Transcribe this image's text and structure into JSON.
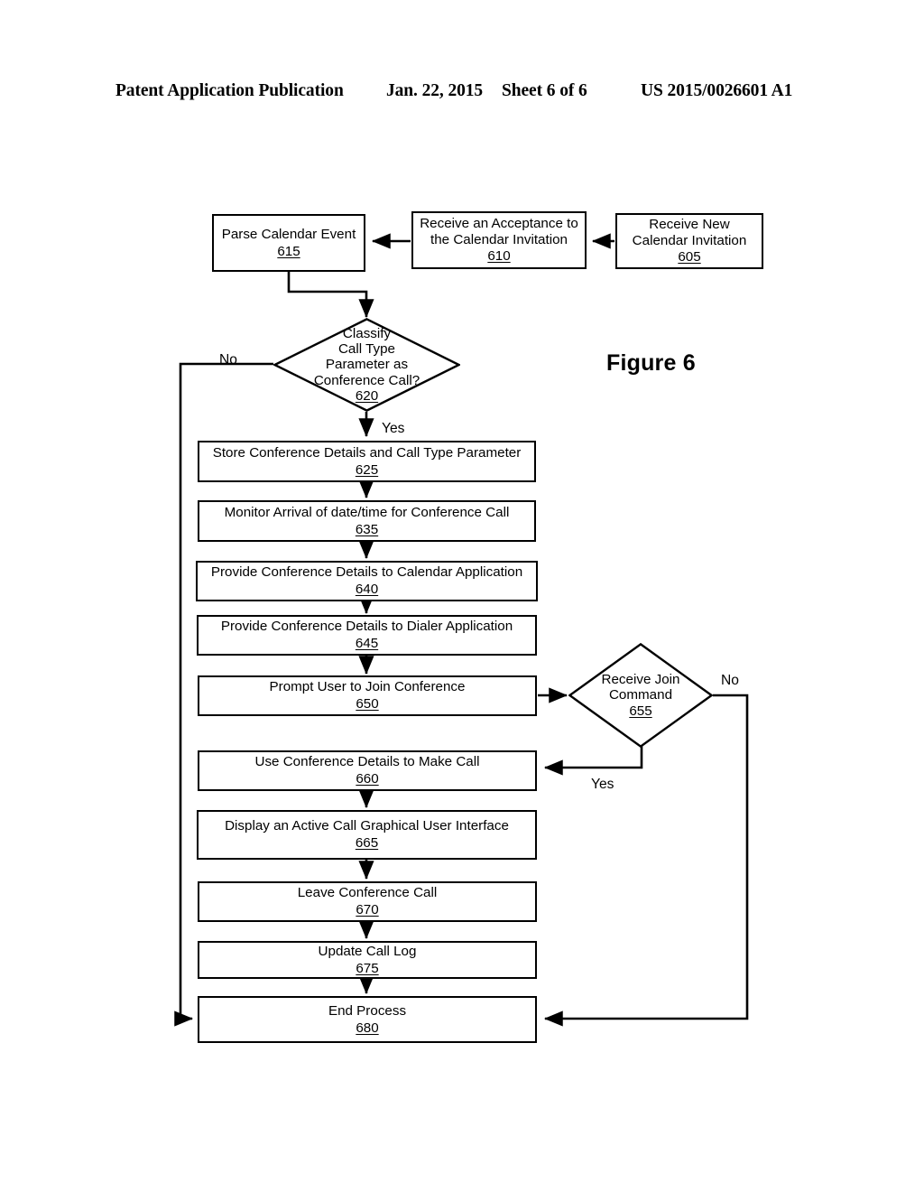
{
  "header": {
    "publication": "Patent Application Publication",
    "date": "Jan. 22, 2015",
    "sheet": "Sheet 6 of 6",
    "number": "US 2015/0026601 A1"
  },
  "figure": {
    "label": "Figure 6"
  },
  "flowchart": {
    "type": "flowchart",
    "nodes": [
      {
        "id": "605",
        "shape": "process",
        "text": "Receive New\nCalendar Invitation",
        "ref": "605"
      },
      {
        "id": "610",
        "shape": "process",
        "text": "Receive an Acceptance to\nthe Calendar Invitation",
        "ref": "610"
      },
      {
        "id": "615",
        "shape": "process",
        "text": "Parse Calendar Event",
        "ref": "615"
      },
      {
        "id": "620",
        "shape": "decision",
        "text": "Classify\nCall Type\nParameter as\nConference Call?",
        "ref": "620"
      },
      {
        "id": "625",
        "shape": "process",
        "text": "Store Conference Details and Call Type Parameter",
        "ref": "625"
      },
      {
        "id": "635",
        "shape": "process",
        "text": "Monitor Arrival of date/time for Conference Call",
        "ref": "635"
      },
      {
        "id": "640",
        "shape": "process",
        "text": "Provide Conference Details to Calendar Application",
        "ref": "640"
      },
      {
        "id": "645",
        "shape": "process",
        "text": "Provide Conference Details to Dialer Application",
        "ref": "645"
      },
      {
        "id": "650",
        "shape": "process",
        "text": "Prompt User to Join Conference",
        "ref": "650"
      },
      {
        "id": "655",
        "shape": "decision",
        "text": "Receive Join\nCommand",
        "ref": "655"
      },
      {
        "id": "660",
        "shape": "process",
        "text": "Use Conference Details to Make Call",
        "ref": "660"
      },
      {
        "id": "665",
        "shape": "process",
        "text": "Display an Active Call Graphical User Interface",
        "ref": "665"
      },
      {
        "id": "670",
        "shape": "process",
        "text": "Leave Conference Call",
        "ref": "670"
      },
      {
        "id": "675",
        "shape": "process",
        "text": "Update Call Log",
        "ref": "675"
      },
      {
        "id": "680",
        "shape": "process",
        "text": "End Process",
        "ref": "680"
      }
    ],
    "edge_labels": {
      "no_620": "No",
      "yes_620": "Yes",
      "no_655": "No",
      "yes_655": "Yes"
    },
    "edges": [
      {
        "from": "605",
        "to": "610",
        "label": ""
      },
      {
        "from": "610",
        "to": "615",
        "label": ""
      },
      {
        "from": "615",
        "to": "620",
        "label": ""
      },
      {
        "from": "620",
        "to": "625",
        "label": "Yes"
      },
      {
        "from": "620",
        "to": "680",
        "label": "No"
      },
      {
        "from": "625",
        "to": "635",
        "label": ""
      },
      {
        "from": "635",
        "to": "640",
        "label": ""
      },
      {
        "from": "640",
        "to": "645",
        "label": ""
      },
      {
        "from": "645",
        "to": "650",
        "label": ""
      },
      {
        "from": "650",
        "to": "655",
        "label": ""
      },
      {
        "from": "655",
        "to": "660",
        "label": "Yes"
      },
      {
        "from": "655",
        "to": "680",
        "label": "No"
      },
      {
        "from": "660",
        "to": "665",
        "label": ""
      },
      {
        "from": "665",
        "to": "670",
        "label": ""
      },
      {
        "from": "670",
        "to": "675",
        "label": ""
      },
      {
        "from": "675",
        "to": "680",
        "label": ""
      }
    ]
  },
  "colors": {
    "ink": "#000000",
    "paper": "#ffffff"
  }
}
